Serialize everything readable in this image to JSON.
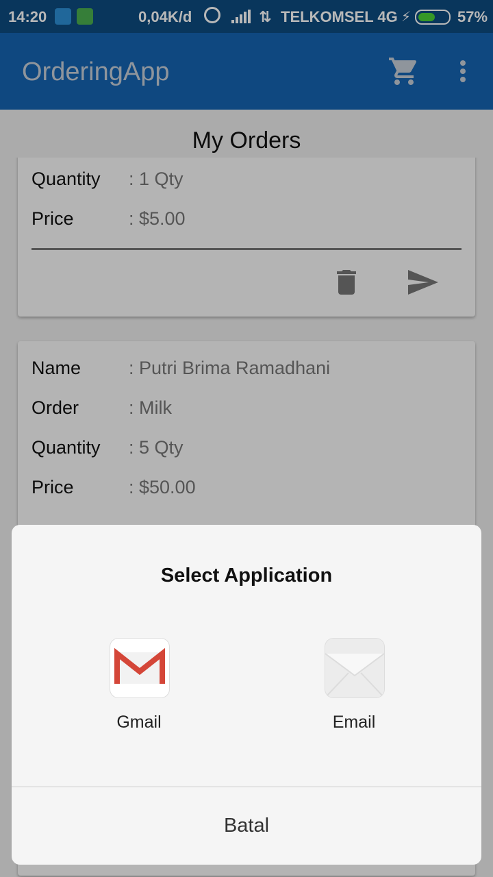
{
  "status_bar": {
    "time": "14:20",
    "network_speed": "0,04K/d",
    "carrier": "TELKOMSEL 4G",
    "battery_percent": "57%",
    "battery_level": 0.57,
    "icons": [
      "usb-icon",
      "android-debug-icon",
      "alarm-icon",
      "signal-icon",
      "data-arrows-icon",
      "charging-icon",
      "battery-icon"
    ]
  },
  "toolbar": {
    "title": "OrderingApp",
    "actions": [
      "cart-icon",
      "overflow-menu-icon"
    ]
  },
  "page": {
    "title": "My Orders"
  },
  "orders": [
    {
      "quantity_label": "Quantity",
      "quantity_value": ": 1 Qty",
      "price_label": "Price",
      "price_value": ": $5.00",
      "actions": [
        "delete-icon",
        "send-icon"
      ]
    },
    {
      "name_label": "Name",
      "name_value": ": Putri Brima Ramadhani",
      "order_label": "Order",
      "order_value": ": Milk",
      "quantity_label": "Quantity",
      "quantity_value": ": 5 Qty",
      "price_label": "Price",
      "price_value": ": $50.00"
    }
  ],
  "chooser": {
    "title": "Select Application",
    "apps": [
      {
        "name": "Gmail",
        "icon": "gmail-icon"
      },
      {
        "name": "Email",
        "icon": "email-envelope-icon"
      }
    ],
    "cancel_label": "Batal"
  },
  "colors": {
    "status_bar": "#0d4c80",
    "toolbar": "#1565b2",
    "gmail_red": "#d44638",
    "battery_green": "#4cd137"
  }
}
